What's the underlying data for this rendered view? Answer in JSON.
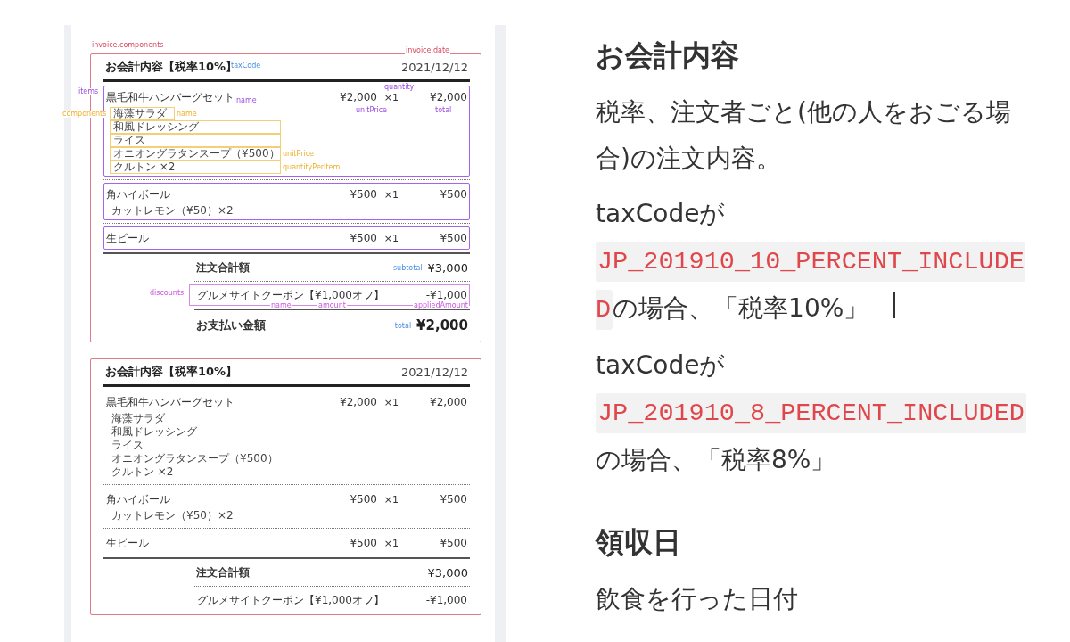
{
  "figure": {
    "receipts": [
      {
        "annotated": true,
        "title": "お会計内容【税率10%】",
        "date": "2021/12/12",
        "labels": {
          "components": "invoice.components",
          "date": "invoice.date",
          "tax_code": "taxCode",
          "items": "items",
          "subtotal": "subtotal",
          "discounts": "discounts",
          "total": "total"
        },
        "items": [
          {
            "name": "黒毛和牛ハンバーグセット",
            "unit_price": "¥2,000",
            "quantity": "×1",
            "total": "¥2,000",
            "labels": {
              "name": "name",
              "quantity": "quantity",
              "unit_price": "unitPrice",
              "total": "total"
            },
            "component_labels": {
              "group": "components",
              "name": "name",
              "unit_price": "unitPrice",
              "quantity": "quantityPerItem"
            },
            "components": [
              "海藻サラダ",
              "和風ドレッシング",
              "ライス",
              "オニオングラタンスープ（¥500）",
              "クルトン ×2"
            ]
          },
          {
            "name": "角ハイボール",
            "unit_price": "¥500",
            "quantity": "×1",
            "total": "¥500",
            "components": [
              "カットレモン（¥50）×2"
            ]
          },
          {
            "name": "生ビール",
            "unit_price": "¥500",
            "quantity": "×1",
            "total": "¥500"
          }
        ],
        "subtotal_label": "注文合計額",
        "subtotal": "¥3,000",
        "discounts": [
          {
            "name": "グルメサイトクーポン【¥1,000オフ】",
            "amount": "-¥1,000",
            "labels": {
              "name": "name",
              "amount": "amount",
              "applied_amount": "appliedAmount"
            }
          }
        ],
        "total_label": "お支払い金額",
        "total": "¥2,000"
      },
      {
        "annotated": false,
        "title": "お会計内容【税率10%】",
        "date": "2021/12/12",
        "items": [
          {
            "name": "黒毛和牛ハンバーグセット",
            "unit_price": "¥2,000",
            "quantity": "×1",
            "total": "¥2,000",
            "components": [
              "海藻サラダ",
              "和風ドレッシング",
              "ライス",
              "オニオングラタンスープ（¥500）",
              "クルトン ×2"
            ]
          },
          {
            "name": "角ハイボール",
            "unit_price": "¥500",
            "quantity": "×1",
            "total": "¥500",
            "components": [
              "カットレモン（¥50）×2"
            ]
          },
          {
            "name": "生ビール",
            "unit_price": "¥500",
            "quantity": "×1",
            "total": "¥500"
          }
        ],
        "subtotal_label": "注文合計額",
        "subtotal": "¥3,000",
        "discounts": [
          {
            "name": "グルメサイトクーポン【¥1,000オフ】",
            "amount": "-¥1,000"
          }
        ]
      }
    ]
  },
  "article": {
    "sections": [
      {
        "heading": "お会計内容",
        "paragraphs": [
          {
            "kind": "text",
            "text": "税率、注文者ごと(他の人をおごる場合)の注文内容。"
          },
          {
            "kind": "code",
            "before": "taxCodeが",
            "code": "JP_201910_10_PERCENT_INCLUDED",
            "after": "の場合、「税率10%」",
            "cursor": true
          },
          {
            "kind": "code",
            "before": "taxCodeが",
            "code": "JP_201910_8_PERCENT_INCLUDED",
            "after": "の場合、「税率8%」",
            "cursor": false
          }
        ]
      },
      {
        "heading": "領収日",
        "paragraphs": [
          {
            "kind": "text",
            "text": "飲食を行った日付"
          }
        ]
      }
    ]
  }
}
